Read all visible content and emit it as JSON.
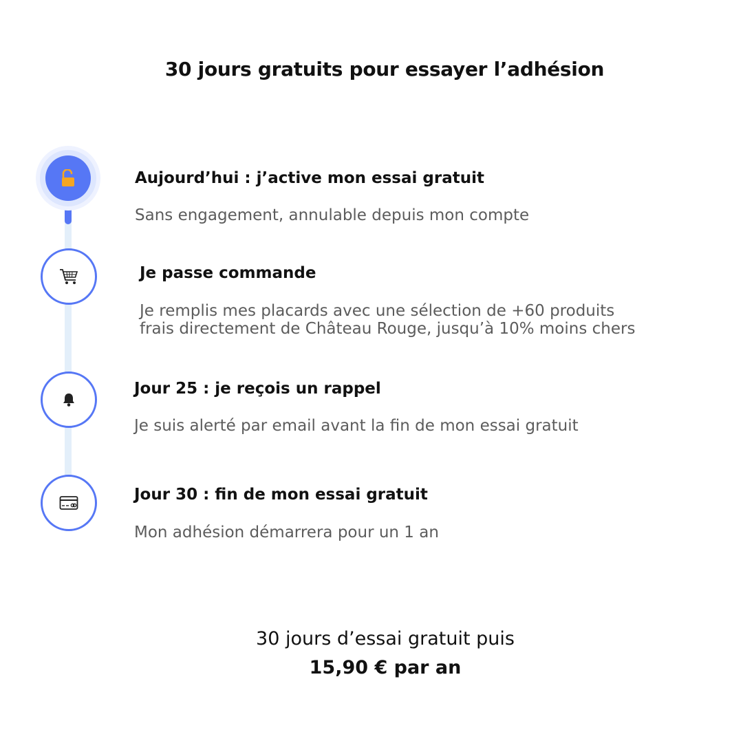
{
  "header": {
    "title": "30 jours gratuits pour essayer l’adhésion"
  },
  "colors": {
    "accent": "#5677f5",
    "rail": "#e3effa",
    "lock": "#f5a623",
    "muted_text": "#5c5c5c"
  },
  "steps": [
    {
      "icon": "unlocked-padlock-icon",
      "title": "Aujourd’hui : j’active mon essai gratuit",
      "description": "Sans engagement, annulable depuis mon compte",
      "active": true
    },
    {
      "icon": "shopping-cart-icon",
      "title": "Je passe commande",
      "description": "Je remplis mes placards avec une sélection de +60 produits frais directement de Château Rouge, jusqu’à 10% moins chers",
      "active": false
    },
    {
      "icon": "bell-icon",
      "title": "Jour 25 : je reçois un rappel",
      "description": "Je suis alerté par email avant la fin de mon essai gratuit",
      "active": false
    },
    {
      "icon": "credit-card-icon",
      "title": "Jour 30 : fin de mon essai gratuit",
      "description": "Mon adhésion démarrera pour un 1 an",
      "active": false
    }
  ],
  "footer": {
    "trial_text": "30 jours d’essai gratuit puis",
    "price_text": "15,90 € par an"
  }
}
